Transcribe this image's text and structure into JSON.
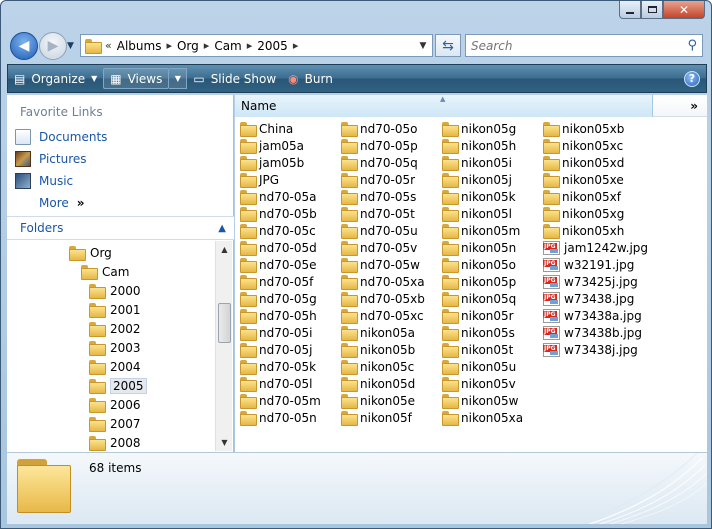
{
  "toolbar": {
    "organize_label": "Organize",
    "views_label": "Views",
    "slideshow_label": "Slide Show",
    "burn_label": "Burn",
    "help_label": "?"
  },
  "address": {
    "overflow": "«",
    "crumbs": [
      "Albums",
      "Org",
      "Cam",
      "2005"
    ]
  },
  "search": {
    "placeholder": "Search"
  },
  "favorites": {
    "header": "Favorite Links",
    "items": [
      "Documents",
      "Pictures",
      "Music",
      "More"
    ]
  },
  "folders": {
    "header": "Folders",
    "tree": [
      "Org",
      "Cam",
      "2000",
      "2001",
      "2002",
      "2003",
      "2004",
      "2005",
      "2006",
      "2007",
      "2008"
    ],
    "selected": "2005"
  },
  "content": {
    "column_name": "Name",
    "files": [
      {
        "name": "China",
        "type": "folder"
      },
      {
        "name": "jam05a",
        "type": "folder"
      },
      {
        "name": "jam05b",
        "type": "folder"
      },
      {
        "name": "JPG",
        "type": "folder"
      },
      {
        "name": "nd70-05a",
        "type": "folder"
      },
      {
        "name": "nd70-05b",
        "type": "folder"
      },
      {
        "name": "nd70-05c",
        "type": "folder"
      },
      {
        "name": "nd70-05d",
        "type": "folder"
      },
      {
        "name": "nd70-05e",
        "type": "folder"
      },
      {
        "name": "nd70-05f",
        "type": "folder"
      },
      {
        "name": "nd70-05g",
        "type": "folder"
      },
      {
        "name": "nd70-05h",
        "type": "folder"
      },
      {
        "name": "nd70-05i",
        "type": "folder"
      },
      {
        "name": "nd70-05j",
        "type": "folder"
      },
      {
        "name": "nd70-05k",
        "type": "folder"
      },
      {
        "name": "nd70-05l",
        "type": "folder"
      },
      {
        "name": "nd70-05m",
        "type": "folder"
      },
      {
        "name": "nd70-05n",
        "type": "folder"
      },
      {
        "name": "nd70-05o",
        "type": "folder"
      },
      {
        "name": "nd70-05p",
        "type": "folder"
      },
      {
        "name": "nd70-05q",
        "type": "folder"
      },
      {
        "name": "nd70-05r",
        "type": "folder"
      },
      {
        "name": "nd70-05s",
        "type": "folder"
      },
      {
        "name": "nd70-05t",
        "type": "folder"
      },
      {
        "name": "nd70-05u",
        "type": "folder"
      },
      {
        "name": "nd70-05v",
        "type": "folder"
      },
      {
        "name": "nd70-05w",
        "type": "folder"
      },
      {
        "name": "nd70-05xa",
        "type": "folder"
      },
      {
        "name": "nd70-05xb",
        "type": "folder"
      },
      {
        "name": "nd70-05xc",
        "type": "folder"
      },
      {
        "name": "nikon05a",
        "type": "folder"
      },
      {
        "name": "nikon05b",
        "type": "folder"
      },
      {
        "name": "nikon05c",
        "type": "folder"
      },
      {
        "name": "nikon05d",
        "type": "folder"
      },
      {
        "name": "nikon05e",
        "type": "folder"
      },
      {
        "name": "nikon05f",
        "type": "folder"
      },
      {
        "name": "nikon05g",
        "type": "folder"
      },
      {
        "name": "nikon05h",
        "type": "folder"
      },
      {
        "name": "nikon05i",
        "type": "folder"
      },
      {
        "name": "nikon05j",
        "type": "folder"
      },
      {
        "name": "nikon05k",
        "type": "folder"
      },
      {
        "name": "nikon05l",
        "type": "folder"
      },
      {
        "name": "nikon05m",
        "type": "folder"
      },
      {
        "name": "nikon05n",
        "type": "folder"
      },
      {
        "name": "nikon05o",
        "type": "folder"
      },
      {
        "name": "nikon05p",
        "type": "folder"
      },
      {
        "name": "nikon05q",
        "type": "folder"
      },
      {
        "name": "nikon05r",
        "type": "folder"
      },
      {
        "name": "nikon05s",
        "type": "folder"
      },
      {
        "name": "nikon05t",
        "type": "folder"
      },
      {
        "name": "nikon05u",
        "type": "folder"
      },
      {
        "name": "nikon05v",
        "type": "folder"
      },
      {
        "name": "nikon05w",
        "type": "folder"
      },
      {
        "name": "nikon05xa",
        "type": "folder"
      },
      {
        "name": "nikon05xb",
        "type": "folder"
      },
      {
        "name": "nikon05xc",
        "type": "folder"
      },
      {
        "name": "nikon05xd",
        "type": "folder"
      },
      {
        "name": "nikon05xe",
        "type": "folder"
      },
      {
        "name": "nikon05xf",
        "type": "folder"
      },
      {
        "name": "nikon05xg",
        "type": "folder"
      },
      {
        "name": "nikon05xh",
        "type": "folder"
      },
      {
        "name": "jam1242w.jpg",
        "type": "jpg"
      },
      {
        "name": "w32191.jpg",
        "type": "jpg"
      },
      {
        "name": "w73425j.jpg",
        "type": "jpg"
      },
      {
        "name": "w73438.jpg",
        "type": "jpg"
      },
      {
        "name": "w73438a.jpg",
        "type": "jpg"
      },
      {
        "name": "w73438b.jpg",
        "type": "jpg"
      },
      {
        "name": "w73438j.jpg",
        "type": "jpg"
      }
    ]
  },
  "details": {
    "item_count": "68 items"
  },
  "colors": {
    "toolbar": "#2f6282",
    "link": "#1a56a6",
    "window_frame": "#a9c6df"
  }
}
